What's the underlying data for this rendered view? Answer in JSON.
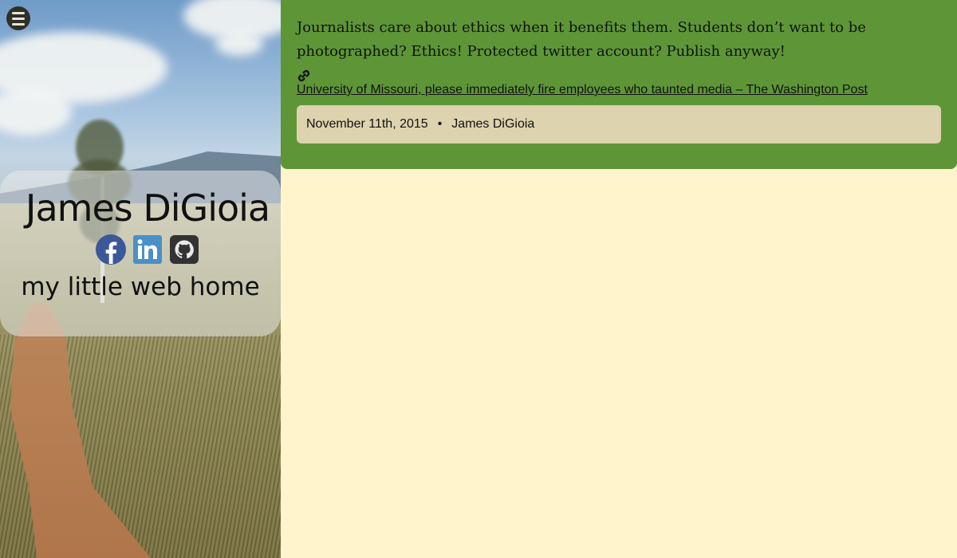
{
  "sidebar": {
    "menu_icon": "hamburger-menu-icon",
    "name": "James DiGioia",
    "tagline": "my little web home",
    "social": [
      {
        "icon": "facebook-icon",
        "color": "#3b5998"
      },
      {
        "icon": "linkedin-icon",
        "color": "#4a90c8"
      },
      {
        "icon": "github-icon",
        "color": "#333333"
      }
    ]
  },
  "post": {
    "body": "Journalists care about ethics when it benefits them. Students don’t want to be photographed? Ethics! Protected twitter account? Publish anyway!",
    "link_icon": "link-icon",
    "link_text": "University of Missouri, please immediately fire employees who taunted media – The Washington Post",
    "date": "November 11th, 2015",
    "separator": "•",
    "author": "James DiGioia"
  },
  "colors": {
    "page_bg": "#fff4cc",
    "post_bg": "#5e9637",
    "meta_bg": "#ddd3ae"
  }
}
